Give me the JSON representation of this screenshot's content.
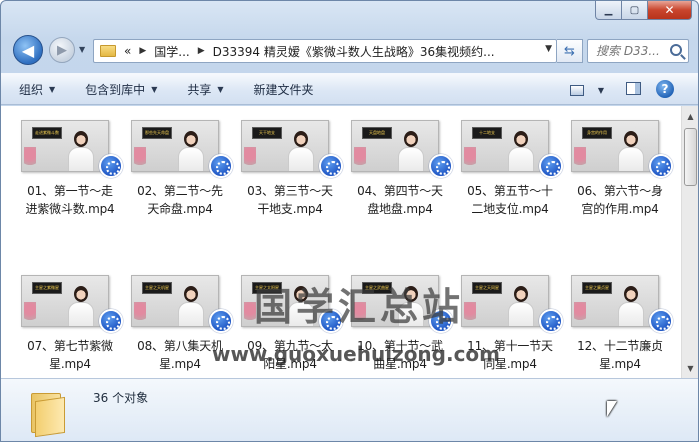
{
  "address": {
    "breadcrumb": [
      "«",
      "国学...",
      "D33394 精灵嫒《紫微斗数人生战略》36集视频约..."
    ]
  },
  "search": {
    "placeholder": "搜索 D33..."
  },
  "toolbar": {
    "organize": "组织",
    "include_library": "包含到库中",
    "share": "共享",
    "new_folder": "新建文件夹"
  },
  "files": [
    {
      "line1": "01、第一节～走",
      "line2": "进紫微斗数.mp4",
      "slide": "走进紫微斗数"
    },
    {
      "line1": "02、第二节～先",
      "line2": "天命盘.mp4",
      "slide": "那些先天命盘"
    },
    {
      "line1": "03、第三节～天",
      "line2": "干地支.mp4",
      "slide": "天干地支"
    },
    {
      "line1": "04、第四节～天",
      "line2": "盘地盘.mp4",
      "slide": "天盘地盘"
    },
    {
      "line1": "05、第五节～十",
      "line2": "二地支位.mp4",
      "slide": "十二地支"
    },
    {
      "line1": "06、第六节～身",
      "line2": "宫的作用.mp4",
      "slide": "身宫的作用"
    },
    {
      "line1": "07、第七节紫微",
      "line2": "星.mp4",
      "slide": "主星之紫微星"
    },
    {
      "line1": "08、第八集天机",
      "line2": "星.mp4",
      "slide": "主星之天机星"
    },
    {
      "line1": "09、第九节～太",
      "line2": "阳星.mp4",
      "slide": "主星之太阳星"
    },
    {
      "line1": "10、第十节～武",
      "line2": "曲星.mp4",
      "slide": "主星之武曲星"
    },
    {
      "line1": "11、第十一节天",
      "line2": "同星.mp4",
      "slide": "主星之天同星"
    },
    {
      "line1": "12、十二节廉贞",
      "line2": "星.mp4",
      "slide": "主星之廉贞星"
    }
  ],
  "watermark": {
    "title": "国学汇总站",
    "url": "www.guoxuehuizong.com"
  },
  "status": {
    "count": "36 个对象"
  }
}
